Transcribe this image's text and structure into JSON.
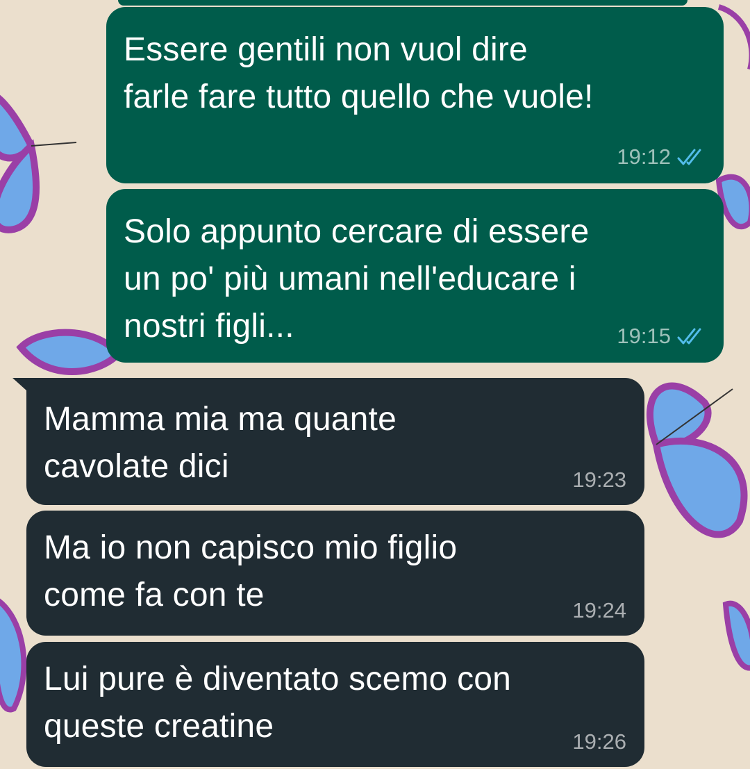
{
  "chat": {
    "messages": [
      {
        "direction": "outgoing",
        "text": "Essere gentili non vuol dire\nfarle fare tutto quello che vuole!",
        "time": "19:12",
        "status": "read"
      },
      {
        "direction": "outgoing",
        "text": "Solo appunto cercare di essere\nun po' più umani nell'educare i\nnostri figli...",
        "time": "19:15",
        "status": "read"
      },
      {
        "direction": "incoming",
        "text": "Mamma mia ma quante\ncavolate dici",
        "time": "19:23"
      },
      {
        "direction": "incoming",
        "text": "Ma io non capisco mio figlio\ncome fa con te",
        "time": "19:24"
      },
      {
        "direction": "incoming",
        "text": "Lui pure è diventato scemo con\nqueste creatine",
        "time": "19:26"
      }
    ]
  },
  "colors": {
    "outgoing_bubble": "#005c4b",
    "incoming_bubble": "#202c33",
    "read_ticks": "#53bdeb",
    "wallpaper": "#ebdfcd",
    "butterfly_blue": "#6fa8e8",
    "butterfly_purple": "#9a3fa6"
  },
  "icons": {
    "read_receipt": "double-check-icon",
    "wallpaper_motif": "butterfly-icon"
  }
}
